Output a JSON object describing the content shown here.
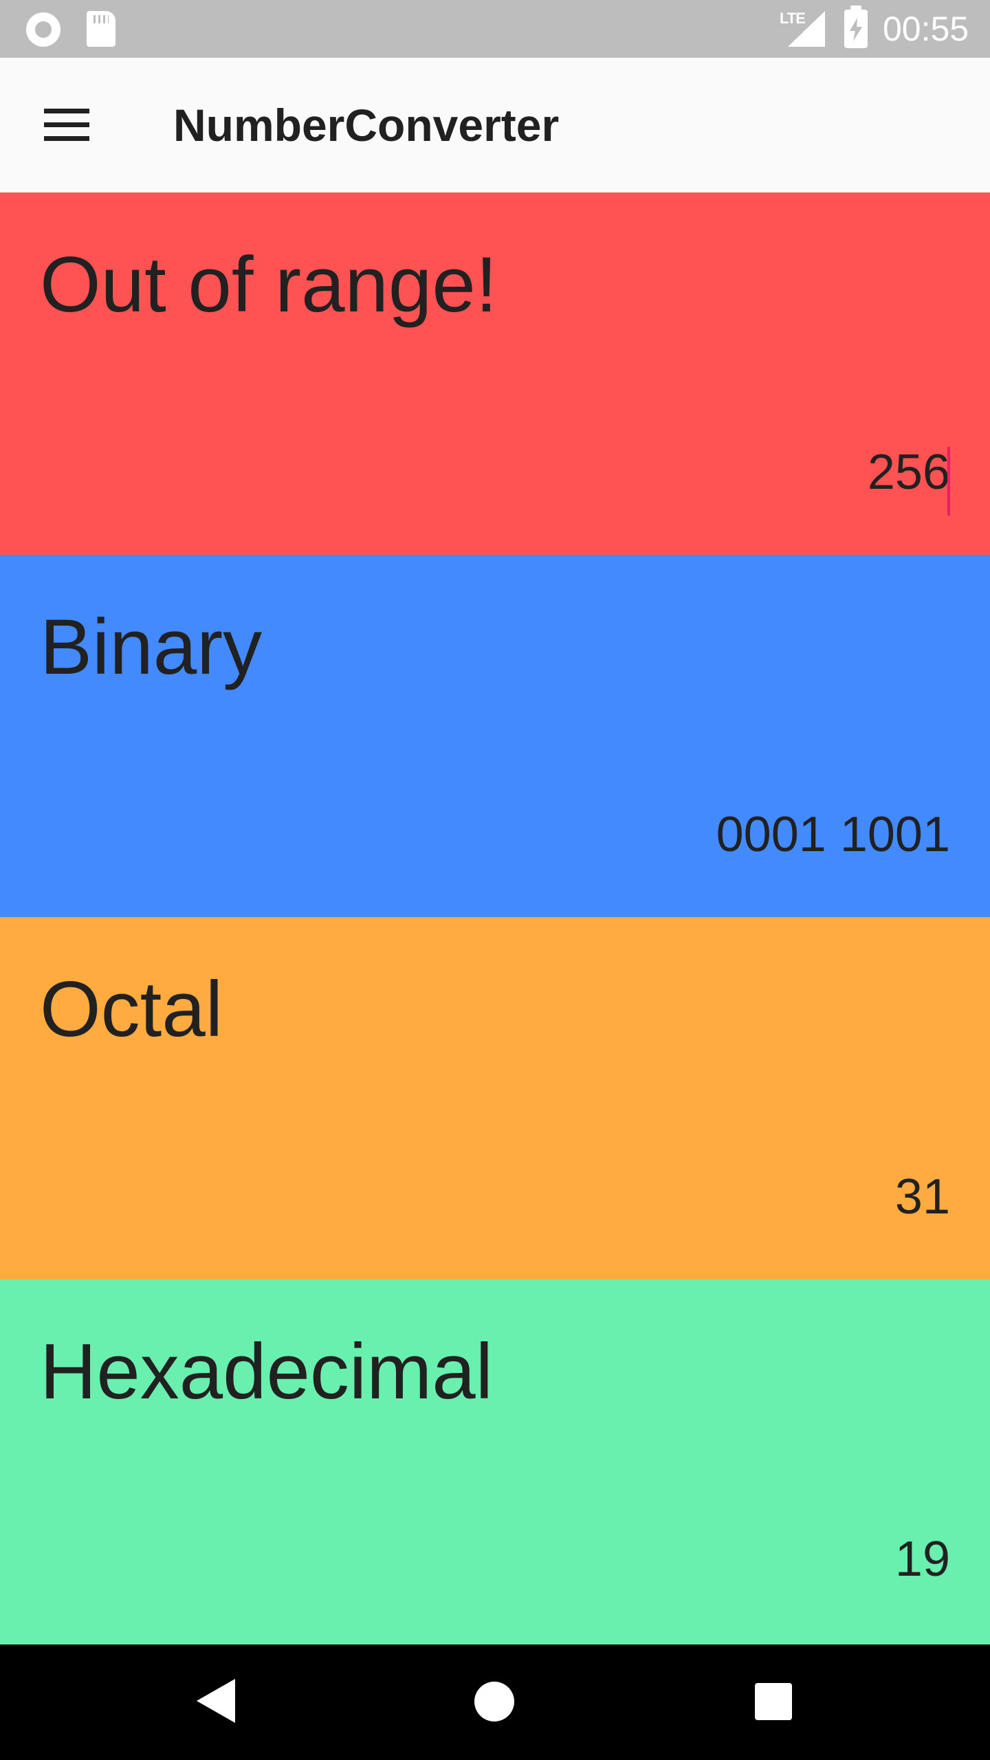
{
  "status_bar": {
    "time": "00:55",
    "network": "LTE",
    "icons": [
      "record-icon",
      "sd-card-icon",
      "signal-icon",
      "battery-charging-icon"
    ]
  },
  "toolbar": {
    "title": "NumberConverter",
    "menu_icon": "hamburger-menu-icon"
  },
  "panels": [
    {
      "id": "decimal",
      "title": "Out of range!",
      "value": "256",
      "color": "#ff5252",
      "editable": true
    },
    {
      "id": "binary",
      "title": "Binary",
      "value": "0001 1001",
      "color": "#448aff"
    },
    {
      "id": "octal",
      "title": "Octal",
      "value": "31",
      "color": "#ffab40"
    },
    {
      "id": "hexadecimal",
      "title": "Hexadecimal",
      "value": "19",
      "color": "#69f0ae"
    }
  ],
  "colors": {
    "status_bar": "#bdbdbd",
    "toolbar": "#fafafa",
    "text": "#212121",
    "cursor": "#e91e63"
  },
  "nav_bar": {
    "icons": [
      "back-icon",
      "home-icon",
      "recents-icon"
    ]
  }
}
